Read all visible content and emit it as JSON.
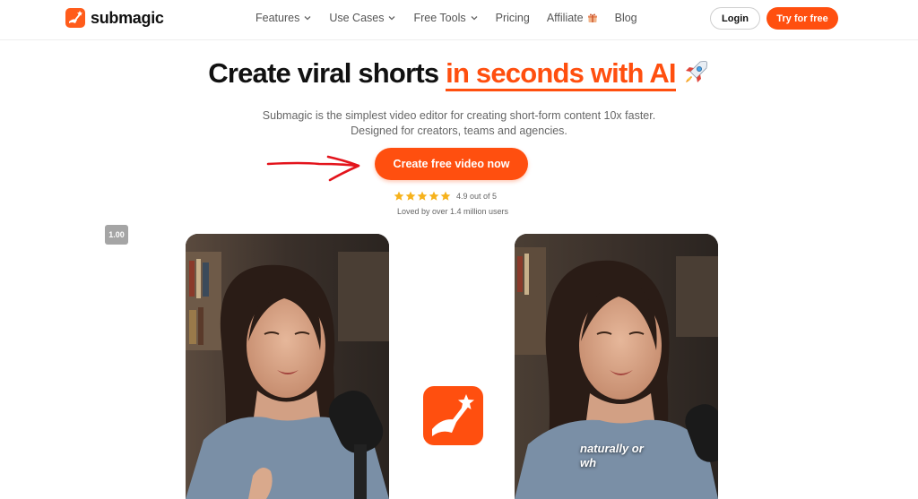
{
  "nav": {
    "brand": "submagic",
    "items": [
      {
        "label": "Features",
        "has_dropdown": true
      },
      {
        "label": "Use Cases",
        "has_dropdown": true
      },
      {
        "label": "Free Tools",
        "has_dropdown": true
      },
      {
        "label": "Pricing",
        "has_dropdown": false
      },
      {
        "label": "Affiliate",
        "has_dropdown": false
      },
      {
        "label": "Blog",
        "has_dropdown": false
      }
    ],
    "login_label": "Login",
    "try_label": "Try for free"
  },
  "hero": {
    "title_plain": "Create viral shorts ",
    "title_accent": "in seconds with AI",
    "subtitle_line1": "Submagic is the simplest video editor for creating short-form content 10x faster.",
    "subtitle_line2": "Designed for creators, teams and agencies.",
    "cta_label": "Create free video now",
    "rating_text": "4.9 out of 5",
    "rating_value": 4.9,
    "rating_max": 5,
    "loved_text": "Loved by over 1.4 million users"
  },
  "player": {
    "speed_badge": "1.00",
    "caption_line1": "naturally or",
    "caption_line2": "wh"
  },
  "colors": {
    "accent": "#ff4f0f",
    "text": "#111111",
    "muted": "#666666"
  }
}
